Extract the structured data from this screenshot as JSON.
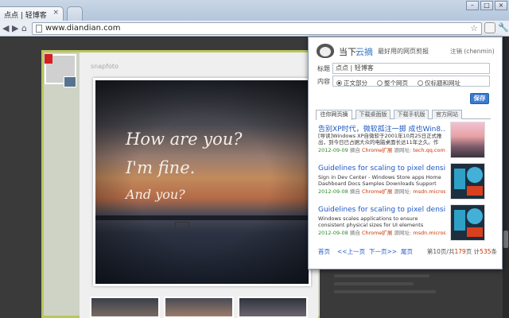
{
  "browser": {
    "tab_title": "点点 | 轻博客",
    "tab_close": "×",
    "url": "www.diandian.com",
    "back": "◀",
    "forward": "▶",
    "home": "⌂",
    "star": "☆",
    "wrench": "🔧",
    "win_min": "–",
    "win_max": "□",
    "win_close": "×"
  },
  "post": {
    "source": "snapfoto",
    "handwriting": [
      "How are you?",
      "I'm fine.",
      "And you?"
    ]
  },
  "popup": {
    "brand_a": "当下",
    "brand_b": "云摘",
    "slogan": "最好用的网页剪报",
    "logout": "注销 (chenmin)",
    "title_label": "标题",
    "title_value": "点点 | 轻博客",
    "content_label": "内容",
    "options": [
      "正文部分",
      "整个网页",
      "仅标题和网址"
    ],
    "selected_option": "正文部分",
    "save": "保存",
    "tabs": [
      "往你网页摘",
      "下载桌面版",
      "下载手机版",
      "官方网站"
    ],
    "results": [
      {
        "title": "告别XP时代，微软孤注一掷 成也Win8...",
        "snippet": "[导读]Windows XP自微软于2001年10月25日正式推出，到今日已占据大众的电脑桌面长达11年之久。作",
        "date": "2012-09-09",
        "via": "摘自",
        "tool": "Chrome扩展",
        "src_label": "源网址:",
        "src": "tech.qq.com/a/"
      },
      {
        "title": "Guidelines for scaling to pixel density (...",
        "snippet": "Sign in Dev Center - Windows Store apps Home Dashboard Docs Samples Downloads Support",
        "date": "2012-09-08",
        "via": "摘自",
        "tool": "Chrome扩展",
        "src_label": "源网址:",
        "src": "msdn.microso"
      },
      {
        "title": "Guidelines for scaling to pixel density (...",
        "snippet": "Windows scales applications to ensure consistent physical sizes for UI elements regardless of the pixel",
        "date": "2012-09-08",
        "via": "摘自",
        "tool": "Chrome扩展",
        "src_label": "源网址:",
        "src": "msdn.microso"
      }
    ],
    "pager": {
      "first": "首页",
      "prev": "<<上一页",
      "next": "下一页>>",
      "last": "尾页",
      "stat_a": "第",
      "page": "10",
      "stat_b": "页/共",
      "total_pages": "179",
      "stat_c": "页 计",
      "total_items": "535",
      "stat_d": "条"
    }
  }
}
